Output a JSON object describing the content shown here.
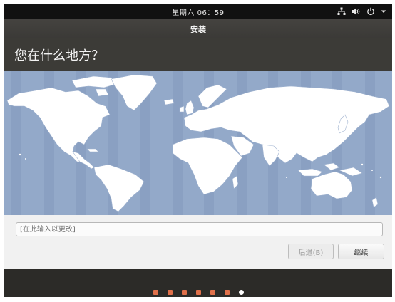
{
  "system_bar": {
    "clock": "星期六 06：59",
    "network_icon": "network-icon",
    "volume_icon": "volume-icon",
    "power_icon": "power-icon",
    "menu_icon": "caret-down-icon"
  },
  "window": {
    "title": "安装"
  },
  "page": {
    "heading": "您在什么地方？"
  },
  "map": {
    "ocean_color": "#93a9c9",
    "land_color": "#ffffff",
    "timezone_band_color": "#8aa0c2"
  },
  "location": {
    "placeholder": "[在此输入以更改]",
    "value": ""
  },
  "buttons": {
    "back_label": "后退(B)",
    "continue_label": "继续"
  },
  "progress": {
    "total_steps": 7,
    "current_step": 7,
    "accent_color": "#e0704a"
  }
}
